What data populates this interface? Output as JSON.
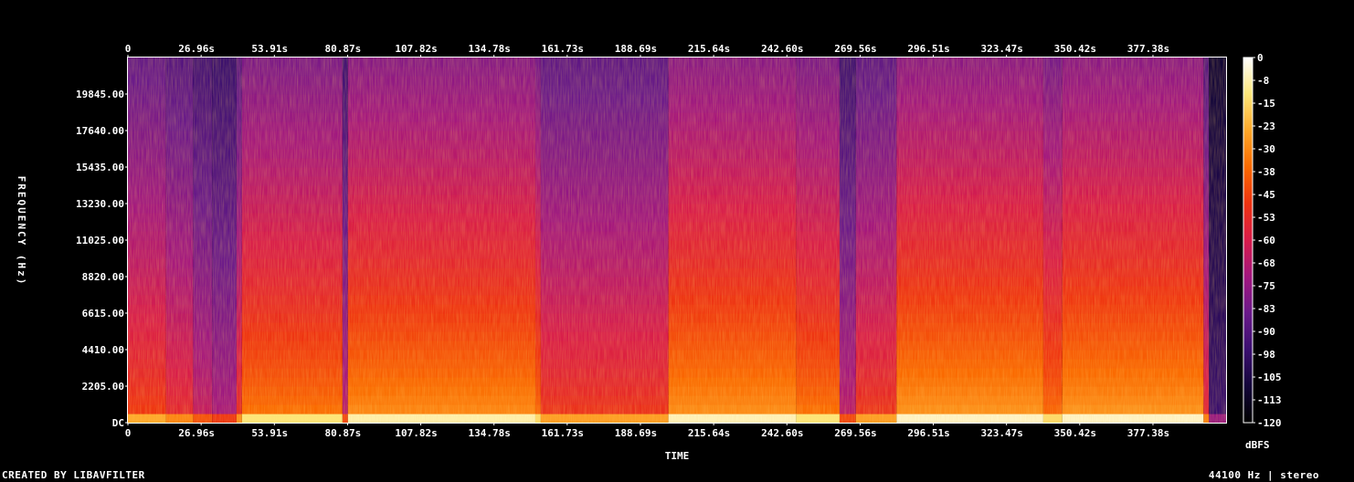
{
  "chart_data": {
    "type": "heatmap",
    "title": "",
    "xlabel": "TIME",
    "ylabel": "FREQUENCY (Hz)",
    "x_ticks": [
      "0",
      "26.96s",
      "53.91s",
      "80.87s",
      "107.82s",
      "134.78s",
      "161.73s",
      "188.69s",
      "215.64s",
      "242.60s",
      "269.56s",
      "296.51s",
      "323.47s",
      "350.42s",
      "377.38s"
    ],
    "x_tick_values": [
      0,
      26.96,
      53.91,
      80.87,
      107.82,
      134.78,
      161.73,
      188.69,
      215.64,
      242.6,
      269.56,
      296.51,
      323.47,
      350.42,
      377.38
    ],
    "xlim": [
      0,
      404.3
    ],
    "y_ticks": [
      "DC",
      "2205.00",
      "4410.00",
      "6615.00",
      "8820.00",
      "11025.00",
      "13230.00",
      "15435.00",
      "17640.00",
      "19845.00"
    ],
    "y_tick_values": [
      0,
      2205,
      4410,
      6615,
      8820,
      11025,
      13230,
      15435,
      17640,
      19845
    ],
    "ylim": [
      0,
      22050
    ],
    "colorbar": {
      "label": "dBFS",
      "ticks": [
        "0",
        "-8",
        "-15",
        "-23",
        "-30",
        "-38",
        "-45",
        "-53",
        "-60",
        "-68",
        "-75",
        "-83",
        "-90",
        "-98",
        "-105",
        "-113",
        "-120"
      ],
      "range": [
        -120,
        0
      ],
      "colors": [
        "#000000",
        "#14063a",
        "#3b0f70",
        "#6a1a8a",
        "#a2177f",
        "#d81c4a",
        "#ee3311",
        "#fa6a00",
        "#fea82a",
        "#fde77a",
        "#ffffff"
      ]
    },
    "segments": [
      {
        "t0": 0,
        "t1": 14,
        "level": 0.62
      },
      {
        "t0": 14,
        "t1": 24,
        "level": 0.56
      },
      {
        "t0": 24,
        "t1": 31,
        "level": 0.47
      },
      {
        "t0": 31,
        "t1": 40,
        "level": 0.42
      },
      {
        "t0": 40,
        "t1": 42,
        "level": 0.58
      },
      {
        "t0": 42,
        "t1": 79,
        "level": 0.72
      },
      {
        "t0": 79,
        "t1": 81,
        "level": 0.45
      },
      {
        "t0": 81,
        "t1": 150,
        "level": 0.76
      },
      {
        "t0": 150,
        "t1": 152,
        "level": 0.7
      },
      {
        "t0": 152,
        "t1": 199,
        "level": 0.6
      },
      {
        "t0": 199,
        "t1": 246,
        "level": 0.77
      },
      {
        "t0": 246,
        "t1": 262,
        "level": 0.72
      },
      {
        "t0": 262,
        "t1": 268,
        "level": 0.45
      },
      {
        "t0": 268,
        "t1": 283,
        "level": 0.6
      },
      {
        "t0": 283,
        "t1": 337,
        "level": 0.78
      },
      {
        "t0": 337,
        "t1": 344,
        "level": 0.7
      },
      {
        "t0": 344,
        "t1": 396,
        "level": 0.78
      },
      {
        "t0": 396,
        "t1": 398,
        "level": 0.55
      },
      {
        "t0": 398,
        "t1": 404.3,
        "level": 0.2
      }
    ]
  },
  "footer": {
    "created": "CREATED BY LIBAVFILTER",
    "info": "44100 Hz | stereo"
  }
}
